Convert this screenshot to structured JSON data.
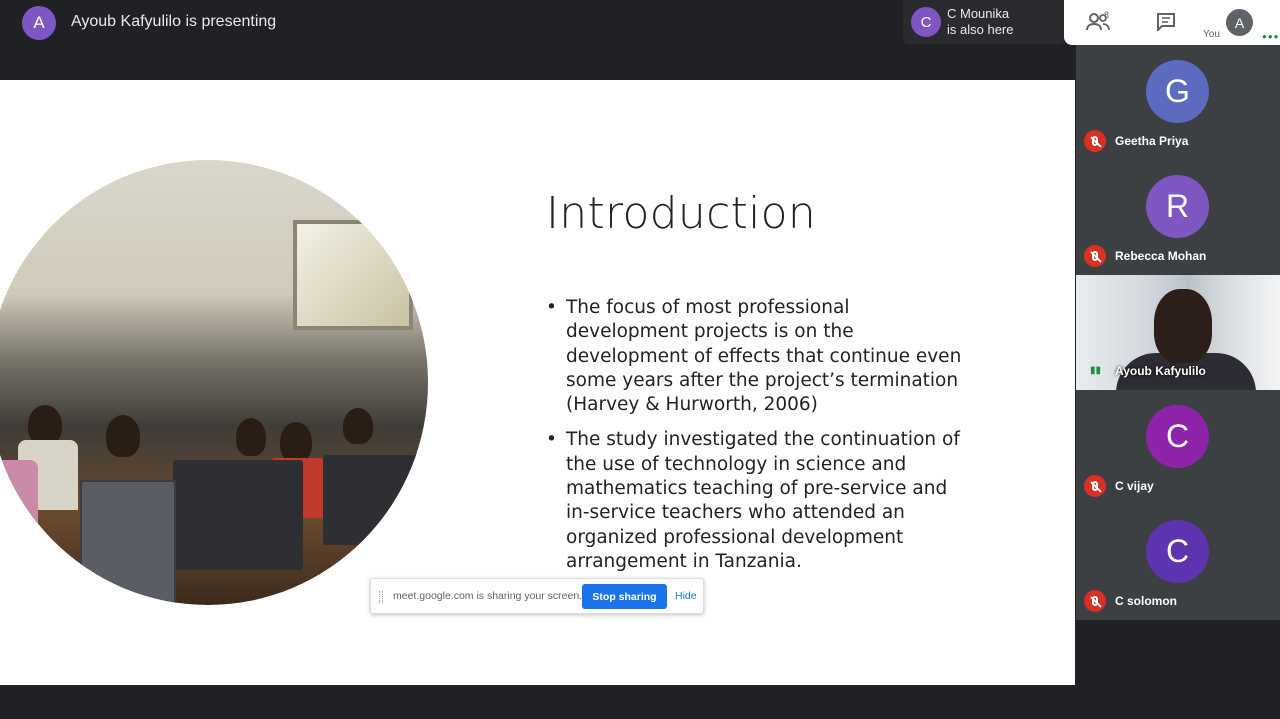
{
  "topbar": {
    "presenter_initial": "A",
    "presenter_text": "Ayoub Kafyulilo is presenting",
    "also_here_initial": "C",
    "also_here_name": "C Mounika",
    "also_here_text": "is also here",
    "people_count": "8",
    "self_initial": "A",
    "self_label": "You"
  },
  "slide": {
    "title": "Introduction",
    "bullets": [
      "The focus of most professional development projects is on the development of effects that continue even some years after the project’s termination (Harvey & Hurworth, 2006)",
      "The study investigated the continuation of the use of technology in science and mathematics teaching of pre-service and in-service teachers who attended an organized professional development arrangement in Tanzania."
    ]
  },
  "share_bar": {
    "message": "meet.google.com is sharing your screen.",
    "stop_label": "Stop sharing",
    "hide_label": "Hide"
  },
  "participants": [
    {
      "initial": "G",
      "name": "Geetha Priya",
      "color": "#5c6bc0"
    },
    {
      "initial": "R",
      "name": "Rebecca Mohan",
      "color": "#7e57c2"
    },
    {
      "initial": "",
      "name": "Ayoub Kafyulilo",
      "color": ""
    },
    {
      "initial": "C",
      "name": "C vijay",
      "color": "#8e24aa"
    },
    {
      "initial": "C",
      "name": "C solomon",
      "color": "#5e35b1"
    }
  ],
  "icons": {
    "people": "people-icon",
    "chat": "chat-icon",
    "mic_off": "mic-off-icon"
  }
}
